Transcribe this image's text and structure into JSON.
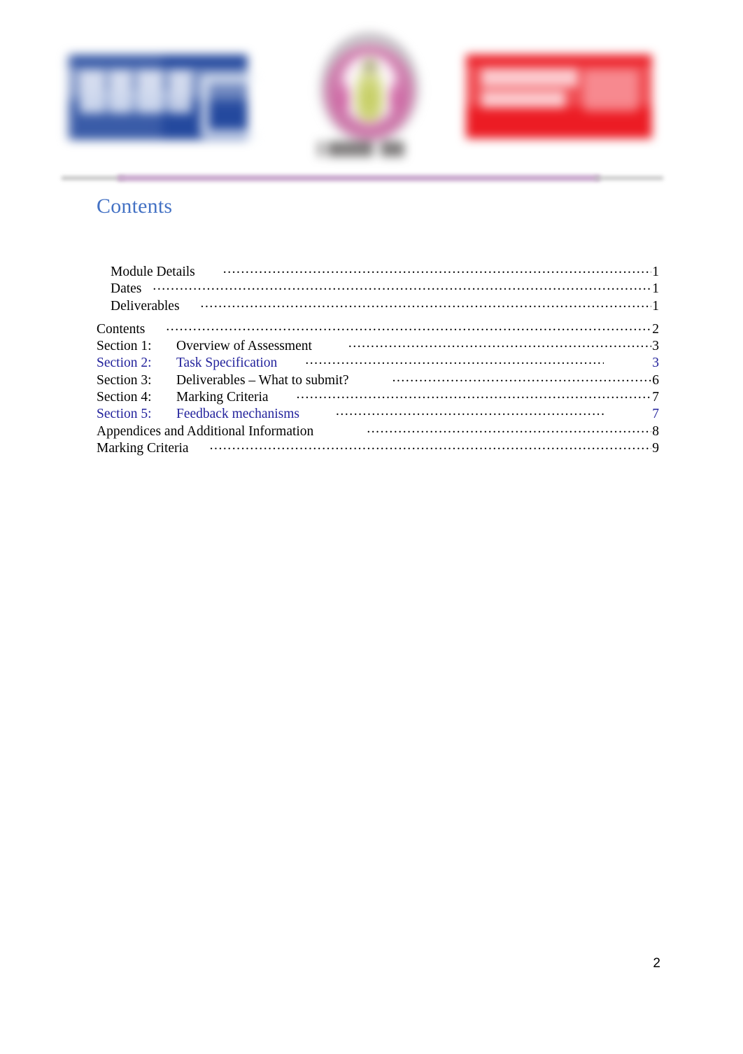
{
  "document": {
    "heading": "Contents",
    "footer_page_number": "2"
  },
  "header": {
    "logos": [
      {
        "name": "ucbt-logo",
        "alt_text": "UCBT",
        "color": "#24499e",
        "redacted": true
      },
      {
        "name": "university-crest-logo",
        "alt_text": "In partnership with",
        "color": "#c6569a",
        "redacted": true
      },
      {
        "name": "university-of-bedfordshire-logo",
        "alt_text": "Univ Bristol",
        "color": "#ec1c24",
        "redacted": true
      }
    ],
    "divider_color": "#c9a8cd"
  },
  "colors": {
    "heading_blue": "#4472c4",
    "link_blue": "#22229c",
    "body_black": "#000000",
    "divider_purple": "#c9a8cd",
    "logo_blue": "#24499e",
    "logo_red": "#ec1c24"
  },
  "toc": {
    "entries": [
      {
        "section": "",
        "title": "Module Details",
        "page": "1",
        "indent": true,
        "link": false,
        "gap_before": false,
        "pre_lead_space": 34
      },
      {
        "section": "",
        "title": "Dates",
        "page": "1",
        "indent": true,
        "link": false,
        "gap_before": false,
        "pre_lead_space": 10
      },
      {
        "section": "",
        "title": "Deliverables",
        "page": "1",
        "indent": true,
        "link": false,
        "gap_before": false,
        "pre_lead_space": 24
      },
      {
        "section": "",
        "title": "Contents",
        "page": "2",
        "indent": false,
        "link": false,
        "gap_before": true,
        "pre_lead_space": 24
      },
      {
        "section": "Section 1:",
        "title": "Overview of Assessment",
        "page": "3",
        "indent": false,
        "link": false,
        "gap_before": false,
        "pre_lead_space": 46
      },
      {
        "section": "Section 2:",
        "title": "Task Specification",
        "page": "3",
        "indent": false,
        "link": true,
        "gap_before": false,
        "pre_lead_space": 34
      },
      {
        "section": "Section 3:",
        "title": "Deliverables – What to submit?",
        "page": "6",
        "indent": false,
        "link": false,
        "gap_before": false,
        "pre_lead_space": 56
      },
      {
        "section": "Section 4:",
        "title": "Marking Criteria",
        "page": "7",
        "indent": false,
        "link": false,
        "gap_before": false,
        "pre_lead_space": 34
      },
      {
        "section": "Section 5:",
        "title": "Feedback mechanisms",
        "page": "7",
        "indent": false,
        "link": true,
        "gap_before": false,
        "pre_lead_space": 46
      },
      {
        "section": "",
        "title": "Appendices and Additional Information",
        "page": "8",
        "indent": false,
        "link": false,
        "gap_before": false,
        "pre_lead_space": 70
      },
      {
        "section": "",
        "title": "Marking Criteria",
        "page": "9",
        "indent": false,
        "link": false,
        "gap_before": false,
        "pre_lead_space": 24
      }
    ]
  }
}
